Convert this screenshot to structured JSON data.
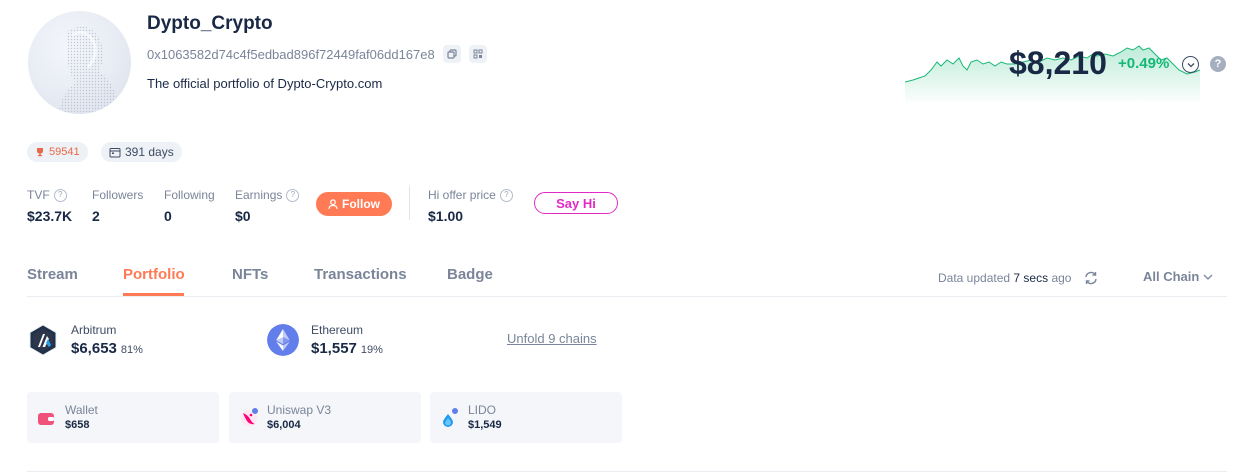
{
  "profile": {
    "name": "Dypto_Crypto",
    "address": "0x1063582d74c4f5edbad896f72449faf06dd167e8",
    "bio": "The official portfolio of Dypto-Crypto.com",
    "rank": "59541",
    "days": "391 days"
  },
  "stats": {
    "tvf_label": "TVF",
    "tvf_value": "$23.7K",
    "followers_label": "Followers",
    "followers_value": "2",
    "following_label": "Following",
    "following_value": "0",
    "earnings_label": "Earnings",
    "earnings_value": "$0",
    "follow_label": "Follow",
    "hi_offer_label": "Hi offer price",
    "hi_offer_value": "$1.00",
    "say_hi_label": "Say Hi"
  },
  "net_worth": {
    "value": "$8,210",
    "change": "+0.49%",
    "accent": "#16b876"
  },
  "tabs": [
    {
      "label": "Stream"
    },
    {
      "label": "Portfolio"
    },
    {
      "label": "NFTs"
    },
    {
      "label": "Transactions"
    },
    {
      "label": "Badge"
    }
  ],
  "toolbar": {
    "updated_prefix": "Data updated",
    "updated_time": "7 secs",
    "updated_suffix": "ago",
    "chain_filter": "All Chain"
  },
  "chains": [
    {
      "name": "Arbitrum",
      "value": "$6,653",
      "pct": "81%",
      "icon": "arbitrum-icon"
    },
    {
      "name": "Ethereum",
      "value": "$1,557",
      "pct": "19%",
      "icon": "ethereum-icon"
    }
  ],
  "unfold_label": "Unfold 9 chains",
  "protocols": [
    {
      "name": "Wallet",
      "value": "$658",
      "icon": "wallet-icon"
    },
    {
      "name": "Uniswap V3",
      "value": "$6,004",
      "icon": "uniswap-icon"
    },
    {
      "name": "LIDO",
      "value": "$1,549",
      "icon": "lido-icon"
    }
  ],
  "colors": {
    "brand": "#ff7a55",
    "sayhi": "#e229c6",
    "positive": "#16b876"
  }
}
